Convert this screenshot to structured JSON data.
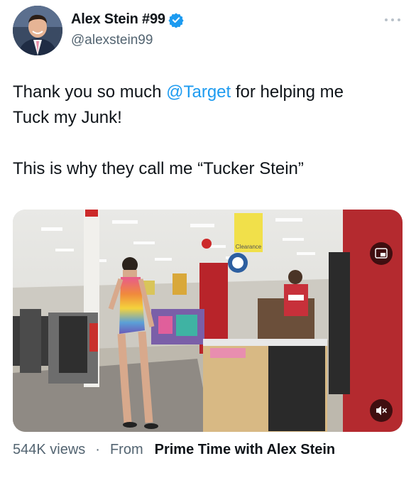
{
  "author": {
    "display_name": "Alex Stein #99",
    "handle": "@alexstein99",
    "verified": true,
    "verified_color": "#1d9bf0"
  },
  "more_icon": "more-horizontal-icon",
  "tweet": {
    "line1_pre": "Thank you so much ",
    "mention": "@Target",
    "line1_post": " for helping me",
    "line2": "Tuck my Junk!",
    "line3": "This is why they call me “Tucker Stein”",
    "mention_color": "#1d9bf0"
  },
  "media": {
    "type": "video",
    "controls": [
      "picture-in-picture-icon",
      "mute-icon"
    ],
    "store_signs": [
      "Clearance"
    ]
  },
  "footer": {
    "views": "544K views",
    "separator": "·",
    "from_label": "From",
    "source": "Prime Time with Alex Stein"
  }
}
